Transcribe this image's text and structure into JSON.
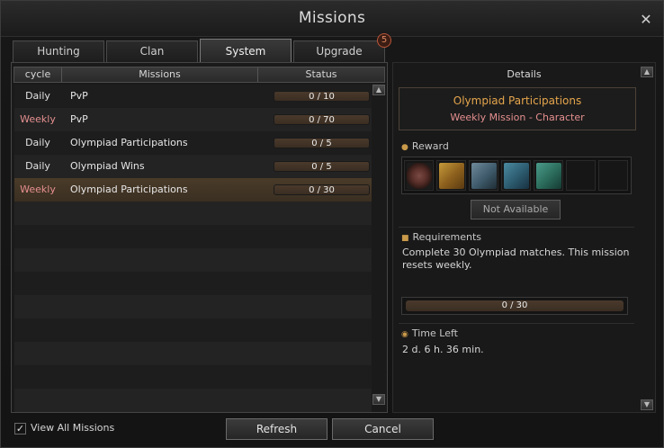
{
  "window": {
    "title": "Missions",
    "close_icon": "close-icon"
  },
  "tabs": [
    {
      "label": "Hunting"
    },
    {
      "label": "Clan"
    },
    {
      "label": "System",
      "active": true
    },
    {
      "label": "Upgrade",
      "badge": "5"
    }
  ],
  "list": {
    "headers": {
      "cycle": "cycle",
      "missions": "Missions",
      "status": "Status"
    },
    "rows": [
      {
        "cycle": "Daily",
        "mission": "PvP",
        "status": "0 / 10"
      },
      {
        "cycle": "Weekly",
        "mission": "PvP",
        "status": "0 / 70"
      },
      {
        "cycle": "Daily",
        "mission": "Olympiad Participations",
        "status": "0 / 5"
      },
      {
        "cycle": "Daily",
        "mission": "Olympiad Wins",
        "status": "0 / 5"
      },
      {
        "cycle": "Weekly",
        "mission": "Olympiad Participations",
        "status": "0 / 30",
        "selected": true
      }
    ]
  },
  "details": {
    "title": "Details",
    "mission_name": "Olympiad Participations",
    "mission_type": "Weekly Mission  -  Character",
    "reward_label": "Reward",
    "not_available_label": "Not Available",
    "requirements_label": "Requirements",
    "requirements_text": "Complete 30 Olympiad matches. This mission resets weekly.",
    "progress_text": "0 / 30",
    "time_left_label": "Time Left",
    "time_left_value": "2 d. 6 h. 36 min."
  },
  "footer": {
    "view_all_label": "View All Missions",
    "view_all_checked": true,
    "refresh_label": "Refresh",
    "cancel_label": "Cancel"
  }
}
